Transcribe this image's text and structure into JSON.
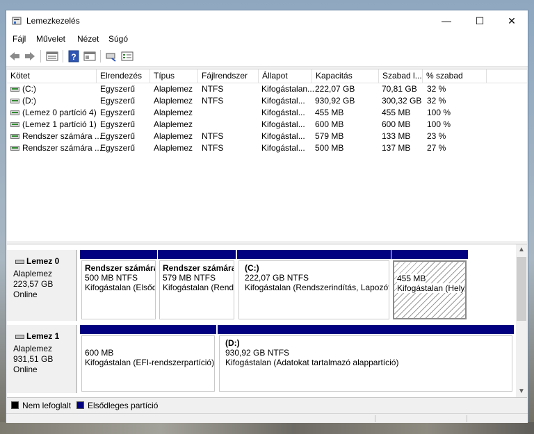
{
  "window": {
    "title": "Lemezkezelés"
  },
  "menu": [
    "Fájl",
    "Művelet",
    "Nézet",
    "Súgó"
  ],
  "toolbar_icons": [
    "back-arrow-icon",
    "forward-arrow-icon",
    "disk-list-icon",
    "help-icon",
    "properties-icon",
    "rescan-icon",
    "settings-icon"
  ],
  "columns": [
    "Kötet",
    "Elrendezés",
    "Típus",
    "Fájlrendszer",
    "Állapot",
    "Kapacitás",
    "Szabad l...",
    "% szabad"
  ],
  "volumes": [
    {
      "name": "(C:)",
      "layout": "Egyszerű",
      "type": "Alaplemez",
      "fs": "NTFS",
      "status": "Kifogástalan...",
      "capacity": "222,07 GB",
      "free": "70,81 GB",
      "pct": "32 %"
    },
    {
      "name": "(D:)",
      "layout": "Egyszerű",
      "type": "Alaplemez",
      "fs": "NTFS",
      "status": "Kifogástal...",
      "capacity": "930,92 GB",
      "free": "300,32 GB",
      "pct": "32 %"
    },
    {
      "name": "(Lemez 0 partíció 4)",
      "layout": "Egyszerű",
      "type": "Alaplemez",
      "fs": "",
      "status": "Kifogástal...",
      "capacity": "455 MB",
      "free": "455 MB",
      "pct": "100 %"
    },
    {
      "name": "(Lemez 1 partíció 1)",
      "layout": "Egyszerű",
      "type": "Alaplemez",
      "fs": "",
      "status": "Kifogástal...",
      "capacity": "600 MB",
      "free": "600 MB",
      "pct": "100 %"
    },
    {
      "name": "Rendszer számára ...",
      "layout": "Egyszerű",
      "type": "Alaplemez",
      "fs": "NTFS",
      "status": "Kifogástal...",
      "capacity": "579 MB",
      "free": "133 MB",
      "pct": "23 %"
    },
    {
      "name": "Rendszer számára ...",
      "layout": "Egyszerű",
      "type": "Alaplemez",
      "fs": "NTFS",
      "status": "Kifogástal...",
      "capacity": "500 MB",
      "free": "137 MB",
      "pct": "27 %"
    }
  ],
  "disks": [
    {
      "name": "Lemez 0",
      "type": "Alaplemez",
      "size": "223,57 GB",
      "state": "Online",
      "partitions": [
        {
          "title": "Rendszer számára",
          "size": "500 MB NTFS",
          "status": "Kifogástalan (Elsődl"
        },
        {
          "title": "Rendszer számára",
          "size": "579 MB NTFS",
          "status": "Kifogástalan (Rend"
        },
        {
          "title": "(C:)",
          "size": "222,07 GB NTFS",
          "status": "Kifogástalan (Rendszerindítás, Lapozófá"
        },
        {
          "title": "",
          "size": "455 MB",
          "status": "Kifogástalan (Hely"
        }
      ]
    },
    {
      "name": "Lemez 1",
      "type": "Alaplemez",
      "size": "931,51 GB",
      "state": "Online",
      "partitions": [
        {
          "title": "",
          "size": "600 MB",
          "status": "Kifogástalan (EFI-rendszerpartíció)"
        },
        {
          "title": "(D:)",
          "size": "930,92 GB NTFS",
          "status": "Kifogástalan (Adatokat tartalmazó alappartíció)"
        }
      ]
    }
  ],
  "legend": {
    "unallocated": "Nem lefoglalt",
    "primary": "Elsődleges partíció"
  },
  "colors": {
    "primary": "#000080",
    "unallocated": "#000000"
  }
}
